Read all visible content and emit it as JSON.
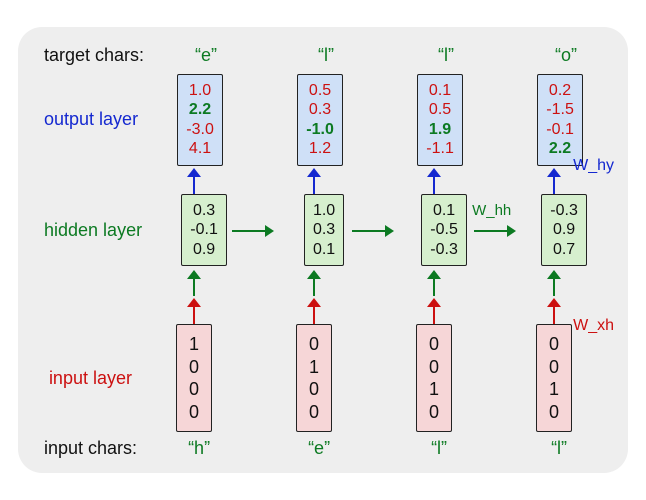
{
  "labels": {
    "target_chars": "target chars:",
    "output_layer": "output layer",
    "hidden_layer": "hidden layer",
    "input_layer": "input layer",
    "input_chars": "input chars:"
  },
  "weights": {
    "w_hy": "W_hy",
    "w_hh": "W_hh",
    "w_xh": "W_xh"
  },
  "target_chars": [
    "“e”",
    "“l”",
    "“l”",
    "“o”"
  ],
  "input_chars": [
    "“h”",
    "“e”",
    "“l”",
    "“l”"
  ],
  "output": [
    [
      {
        "v": "1.0",
        "c": "red"
      },
      {
        "v": "2.2",
        "c": "greenb"
      },
      {
        "v": "-3.0",
        "c": "red"
      },
      {
        "v": "4.1",
        "c": "red"
      }
    ],
    [
      {
        "v": "0.5",
        "c": "red"
      },
      {
        "v": "0.3",
        "c": "red"
      },
      {
        "v": "-1.0",
        "c": "greenb"
      },
      {
        "v": "1.2",
        "c": "red"
      }
    ],
    [
      {
        "v": "0.1",
        "c": "red"
      },
      {
        "v": "0.5",
        "c": "red"
      },
      {
        "v": "1.9",
        "c": "greenb"
      },
      {
        "v": "-1.1",
        "c": "red"
      }
    ],
    [
      {
        "v": "0.2",
        "c": "red"
      },
      {
        "v": "-1.5",
        "c": "red"
      },
      {
        "v": "-0.1",
        "c": "red"
      },
      {
        "v": "2.2",
        "c": "greenb"
      }
    ]
  ],
  "hidden": [
    [
      "0.3",
      "-0.1",
      "0.9"
    ],
    [
      "1.0",
      "0.3",
      "0.1"
    ],
    [
      "0.1",
      "-0.5",
      "-0.3"
    ],
    [
      "-0.3",
      "0.9",
      "0.7"
    ]
  ],
  "input": [
    [
      "1",
      "0",
      "0",
      "0"
    ],
    [
      "0",
      "1",
      "0",
      "0"
    ],
    [
      "0",
      "0",
      "1",
      "0"
    ],
    [
      "0",
      "0",
      "1",
      "0"
    ]
  ],
  "chart_data": {
    "type": "table",
    "description": "RNN character-level unrolled timestep diagram",
    "time_steps": 4,
    "input_chars": [
      "h",
      "e",
      "l",
      "l"
    ],
    "target_chars": [
      "e",
      "l",
      "l",
      "o"
    ],
    "input_vectors": [
      [
        1,
        0,
        0,
        0
      ],
      [
        0,
        1,
        0,
        0
      ],
      [
        0,
        0,
        1,
        0
      ],
      [
        0,
        0,
        1,
        0
      ]
    ],
    "hidden_vectors": [
      [
        0.3,
        -0.1,
        0.9
      ],
      [
        1.0,
        0.3,
        0.1
      ],
      [
        0.1,
        -0.5,
        -0.3
      ],
      [
        -0.3,
        0.9,
        0.7
      ]
    ],
    "output_vectors": [
      [
        1.0,
        2.2,
        -3.0,
        4.1
      ],
      [
        0.5,
        0.3,
        -1.0,
        1.2
      ],
      [
        0.1,
        0.5,
        1.9,
        -1.1
      ],
      [
        0.2,
        -1.5,
        -0.1,
        2.2
      ]
    ],
    "correct_output_index_per_step": [
      1,
      2,
      2,
      3
    ],
    "weight_labels": [
      "W_xh",
      "W_hh",
      "W_hy"
    ]
  }
}
